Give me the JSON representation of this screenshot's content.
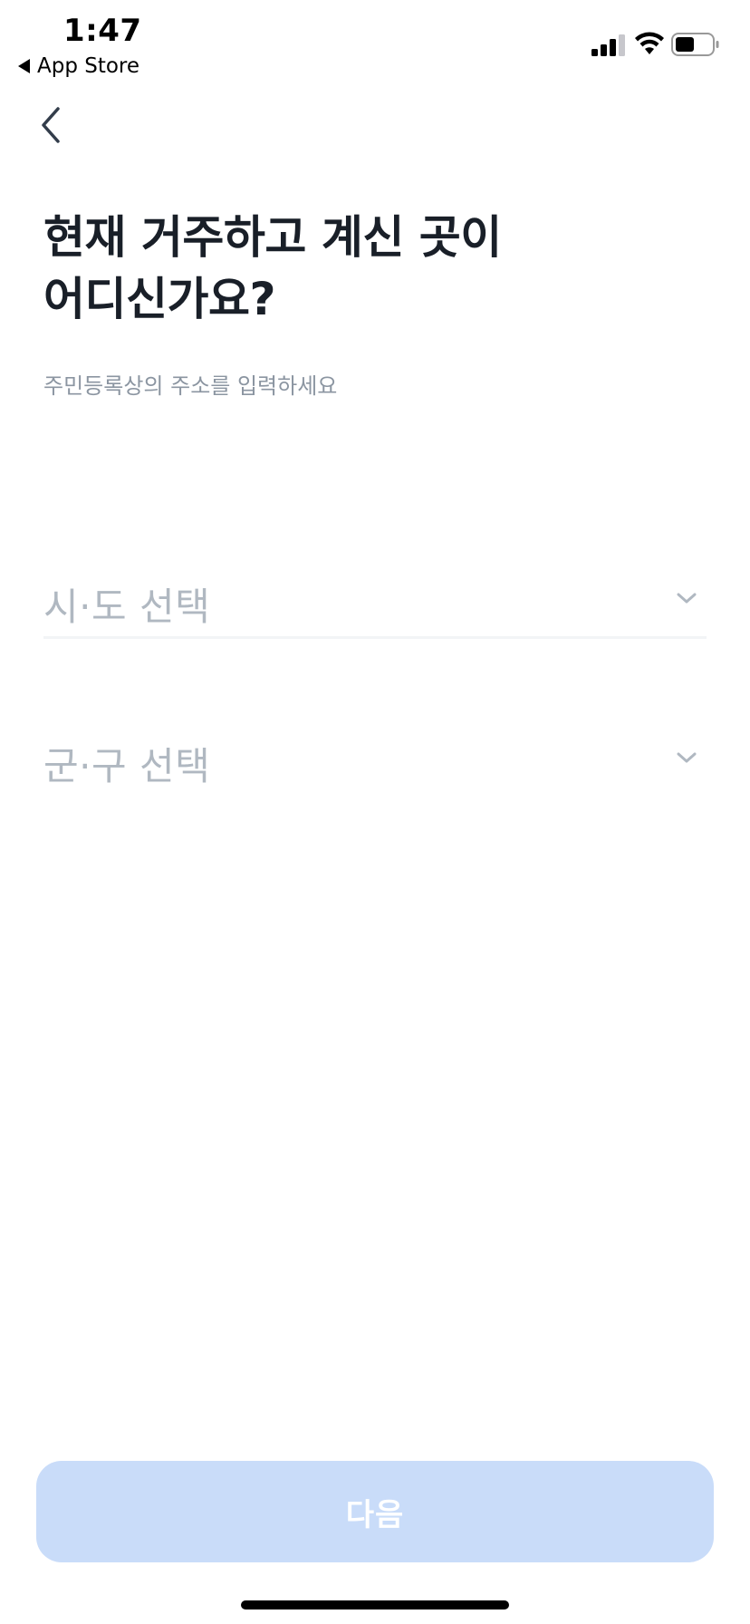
{
  "status_bar": {
    "time": "1:47",
    "back_app_label": "App Store",
    "icons": [
      "signal-icon",
      "wifi-icon",
      "battery-icon"
    ]
  },
  "nav": {
    "back_icon": "chevron-left-icon"
  },
  "header": {
    "title": "현재 거주하고 계신 곳이\n어디신가요?",
    "subtitle": "주민등록상의 주소를 입력하세요"
  },
  "form": {
    "city_select": {
      "label": "시·도 선택",
      "icon": "chevron-down-icon"
    },
    "district_select": {
      "label": "군·구 선택",
      "icon": "chevron-down-icon"
    }
  },
  "footer": {
    "next_label": "다음"
  },
  "colors": {
    "title_text": "#191f28",
    "subtitle_text": "#8b95a1",
    "placeholder_text": "#b0b8c1",
    "chevron": "#b0b8c1",
    "divider": "#f2f4f6",
    "button_disabled_bg": "#c9dcf9",
    "button_text": "#ffffff"
  }
}
